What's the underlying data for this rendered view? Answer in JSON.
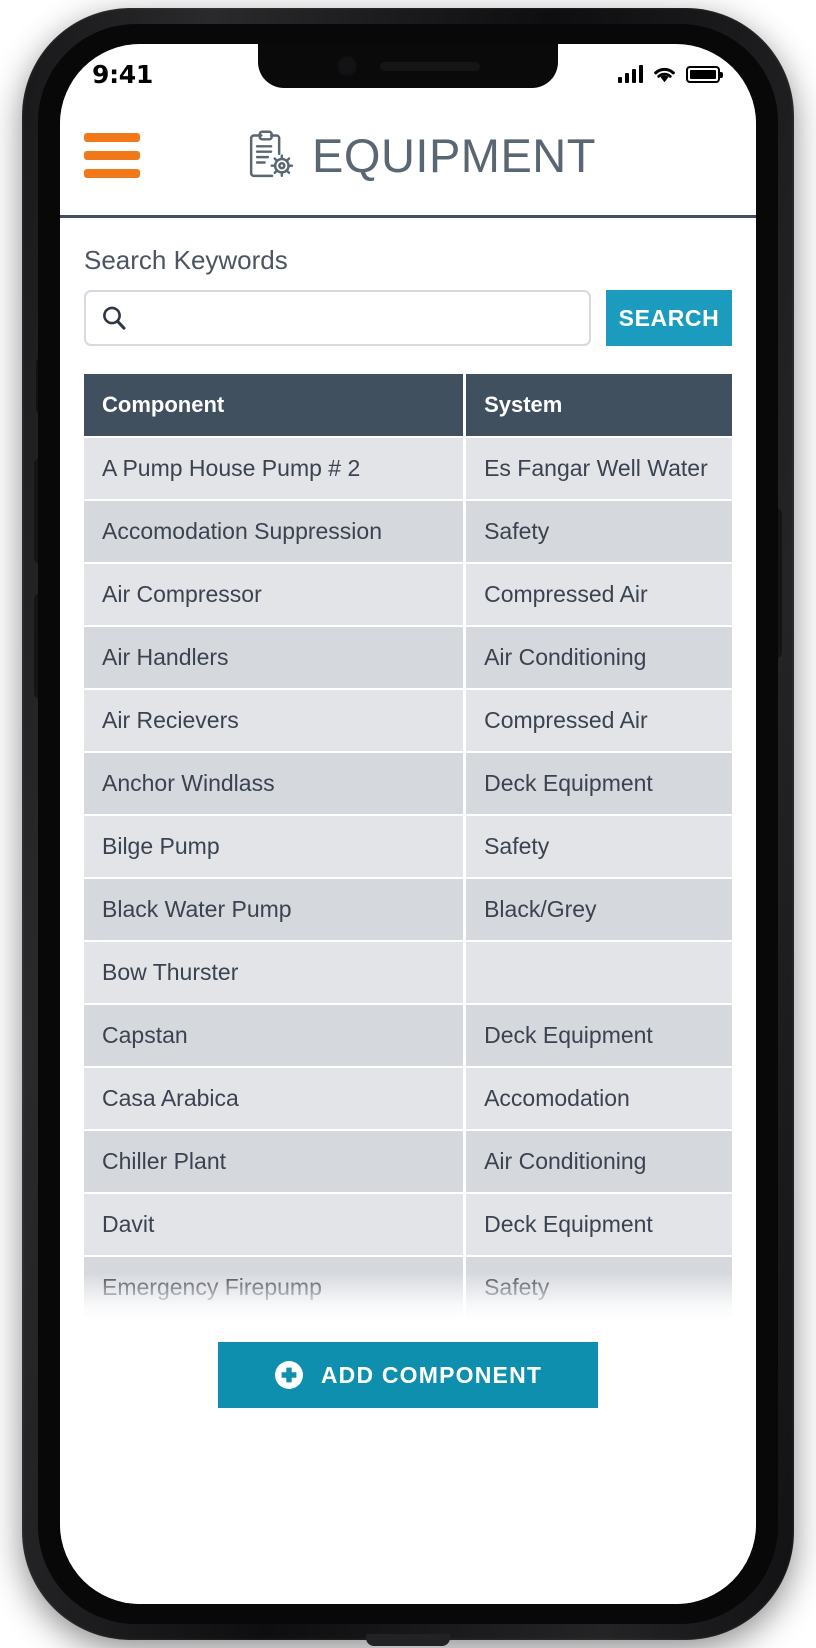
{
  "status_bar": {
    "time": "9:41",
    "signal_icon": "cellular-signal-icon",
    "wifi_icon": "wifi-icon",
    "battery_icon": "battery-full-icon"
  },
  "header": {
    "menu_icon": "hamburger-menu-icon",
    "app_icon": "clipboard-gear-icon",
    "title": "EQUIPMENT",
    "title_color": "#5a6672",
    "menu_color": "#F07818",
    "rule_color": "#41505f"
  },
  "search": {
    "label": "Search Keywords",
    "value": "",
    "placeholder": "",
    "icon": "search-icon",
    "button_label": "SEARCH",
    "button_color": "#1B9CBE"
  },
  "table": {
    "columns": [
      "Component",
      "System"
    ],
    "header_bg": "#41505f",
    "row_bg_odd": "#e2e4e8",
    "row_bg_even": "#d5d8dd",
    "rows": [
      {
        "component": "A Pump House Pump # 2",
        "system": "Es Fangar Well Water"
      },
      {
        "component": "Accomodation Suppression",
        "system": "Safety"
      },
      {
        "component": "Air Compressor",
        "system": "Compressed Air"
      },
      {
        "component": "Air Handlers",
        "system": "Air Conditioning"
      },
      {
        "component": "Air Recievers",
        "system": "Compressed Air"
      },
      {
        "component": "Anchor Windlass",
        "system": "Deck Equipment"
      },
      {
        "component": "Bilge Pump",
        "system": "Safety"
      },
      {
        "component": "Black Water Pump",
        "system": "Black/Grey"
      },
      {
        "component": "Bow Thurster",
        "system": ""
      },
      {
        "component": "Capstan",
        "system": "Deck Equipment"
      },
      {
        "component": "Casa Arabica",
        "system": "Accomodation"
      },
      {
        "component": "Chiller Plant",
        "system": "Air Conditioning"
      },
      {
        "component": "Davit",
        "system": "Deck Equipment"
      },
      {
        "component": "Emergency Firepump",
        "system": "Safety"
      }
    ]
  },
  "add_component": {
    "label": "ADD COMPONENT",
    "icon": "plus-circle-icon",
    "color": "#0E8FAD"
  }
}
